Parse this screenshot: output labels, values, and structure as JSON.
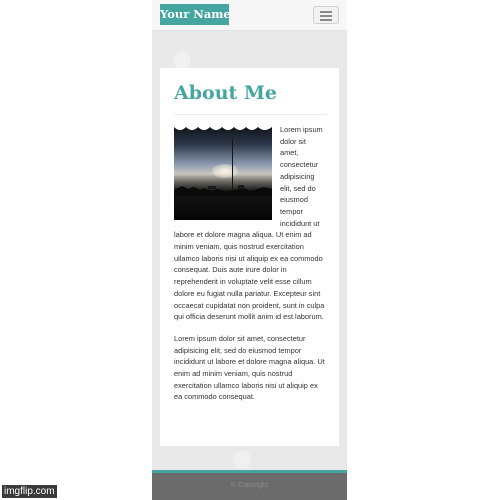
{
  "navbar": {
    "brand": "Your Name",
    "toggle_icon": "hamburger-menu-icon"
  },
  "about": {
    "title": "About Me",
    "photo_icon": "sunset-harbor-photo",
    "paragraph1": "Lorem ipsum dolor sit amet, consectetur adipisicing elit, sed do eiusmod tempor incididunt ut labore et dolore magna aliqua. Ut enim ad minim veniam, quis nostrud exercitation ullamco laboris nisi ut aliquip ex ea commodo consequat. Duis aute irure dolor in reprehenderit in voluptate velit esse cillum dolore eu fugiat nulla pariatur. Excepteur sint occaecat cupidatat non proident, sunt in culpa qui officia deserunt mollit anim id est laborum.",
    "paragraph2": "Lorem ipsum dolor sit amet, consectetur adipisicing elit, sed do eiusmod tempor incididunt ut labore et dolore magna aliqua. Ut enim ad minim veniam, quis nostrud exercitation ullamco laboris nisi ut aliquip ex ea commodo consequat."
  },
  "footer": {
    "text": "© Copyright"
  },
  "watermark": "imgflip.com",
  "colors": {
    "accent": "#45a5a0",
    "footer_bg": "#6b6b6b",
    "page_bg": "#e9e9e9"
  }
}
